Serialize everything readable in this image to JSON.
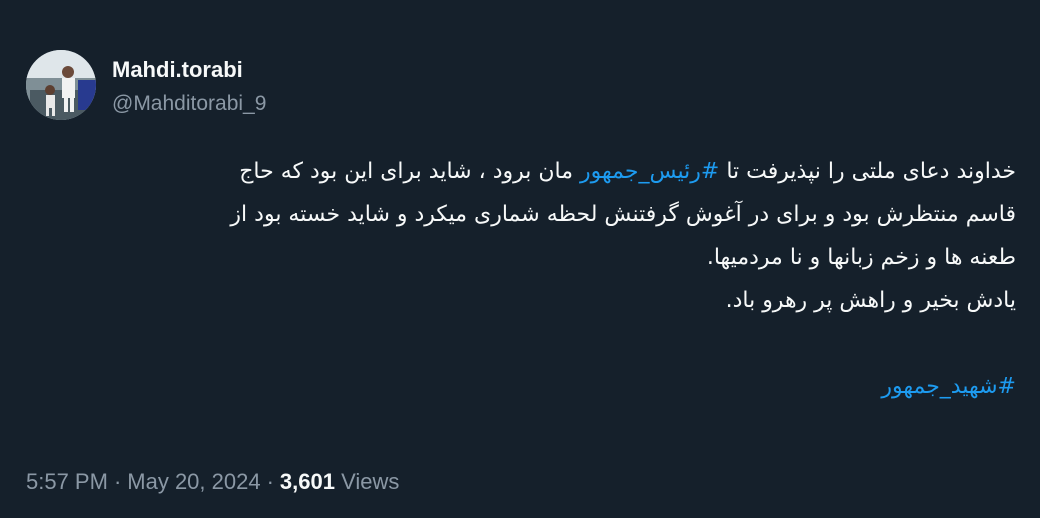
{
  "author": {
    "display_name": "Mahdi.torabi",
    "handle": "@Mahditorabi_9"
  },
  "tweet": {
    "line1_pre": "خداوند دعای ملتی را نپذیرفت تا ",
    "hashtag1": "#رئیس_جمهور",
    "line1_post": " مان برود ، شاید برای این بود که حاج",
    "line2": "قاسم منتظرش بود و برای در آغوش گرفتنش لحظه شماری میکرد و شاید خسته بود از",
    "line3": "طعنه ها و زخم زبانها و نا مردمیها.",
    "line4": "یادش بخیر و راهش پر رهرو باد.",
    "hashtag2": "#شهید_جمهور"
  },
  "meta": {
    "time": "5:57 PM",
    "separator": "·",
    "date": "May 20, 2024",
    "views_count": "3,601",
    "views_label": "Views"
  },
  "colors": {
    "background": "#15202b",
    "text": "#f7f9f9",
    "secondary": "#8b98a5",
    "link": "#1d9bf0"
  }
}
